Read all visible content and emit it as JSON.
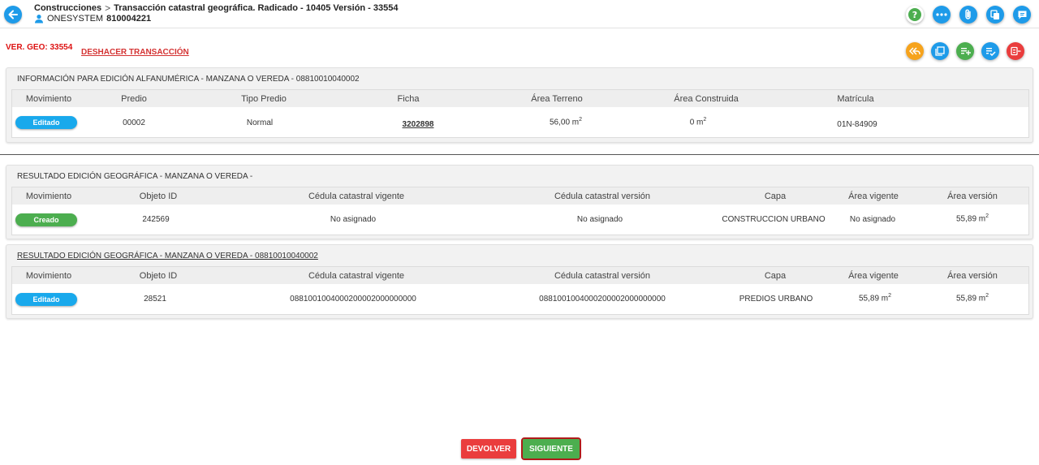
{
  "header": {
    "breadcrumb_root": "Construcciones",
    "breadcrumb_sep": ">",
    "breadcrumb_current": "Transacción catastral geográfica. Radicado - 10405 Versión - 33554",
    "user_name": "ONESYSTEM",
    "user_id": "810004221"
  },
  "ver_geo": "VER. GEO: 33554",
  "undo_label": "DESHACER TRANSACCIÓN",
  "panel1": {
    "title": "INFORMACIÓN PARA EDICIÓN ALFANUMÉRICA - MANZANA O VEREDA - 08810010040002",
    "columns": [
      "Movimiento",
      "Predio",
      "Tipo Predio",
      "Ficha",
      "Área Terreno",
      "Área Construida",
      "Matrícula"
    ],
    "row": {
      "movimiento": "Editado",
      "predio": "00002",
      "tipo_predio": "Normal",
      "ficha": "3202898",
      "area_terreno": "56,00 m",
      "area_construida": "0 m",
      "matricula": "01N-84909"
    }
  },
  "panel2": {
    "title": "RESULTADO EDICIÓN GEOGRÁFICA - MANZANA O VEREDA -",
    "columns": [
      "Movimiento",
      "Objeto ID",
      "Cédula catastral vigente",
      "Cédula catastral versión",
      "Capa",
      "Área vigente",
      "Área versión"
    ],
    "row": {
      "movimiento": "Creado",
      "objeto_id": "242569",
      "cedula_vigente": "No asignado",
      "cedula_version": "No asignado",
      "capa": "CONSTRUCCION URBANO",
      "area_vigente": "No asignado",
      "area_version": "55,89 m"
    }
  },
  "panel3": {
    "title": "RESULTADO EDICIÓN GEOGRÁFICA - MANZANA O VEREDA - 08810010040002",
    "columns": [
      "Movimiento",
      "Objeto ID",
      "Cédula catastral vigente",
      "Cédula catastral versión",
      "Capa",
      "Área vigente",
      "Área versión"
    ],
    "row": {
      "movimiento": "Editado",
      "objeto_id": "28521",
      "cedula_vigente": "0881001004000200002000000000",
      "cedula_version": "0881001004000200002000000000",
      "capa": "PREDIOS URBANO",
      "area_vigente": "55,89 m",
      "area_version": "55,89 m"
    }
  },
  "superscript": "2",
  "footer": {
    "devolver_label": "DEVOLVER",
    "siguiente_label": "SIGUIENTE"
  },
  "colors": {
    "primary_blue": "#1e9be9",
    "green": "#4cae4f",
    "orange": "#f6a31c",
    "red": "#ea3d3d"
  }
}
